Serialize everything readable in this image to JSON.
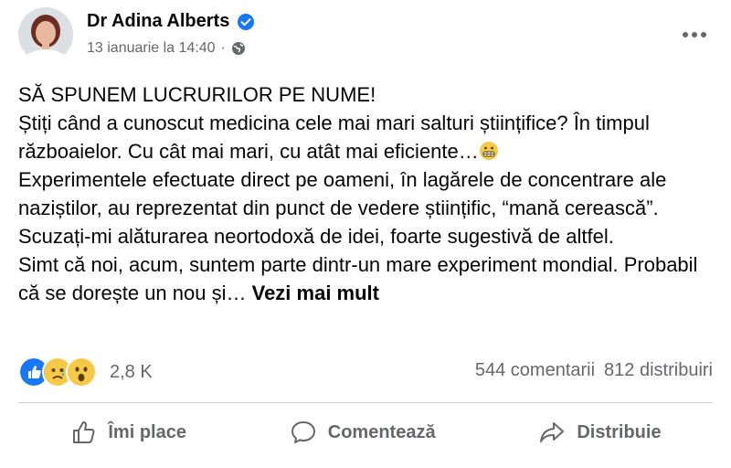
{
  "post": {
    "author": "Dr Adina Alberts",
    "date": "13 ianuarie la 14:40",
    "separator": "·",
    "text_lines": [
      "SĂ SPUNEM LUCRURILOR PE NUME!",
      "Știți când a cunoscut medicina cele mai mari salturi științifice? În timpul războaielor. Cu cât mai mari, cu atât mai eficiente…",
      "Experimentele efectuate direct pe oameni, în lagărele de concentrare ale naziștilor, au reprezentat din punct de vedere științific, “mană cerească”. Scuzați-mi alăturarea neortodoxă de idei, foarte sugestivă de altfel.",
      "Simt că noi, acum, suntem parte dintr-un mare experiment mondial. Probabil că se dorește un nou și…"
    ],
    "see_more": "Vezi mai mult",
    "icons": {
      "verified": "verified-badge-icon",
      "privacy": "globe-icon",
      "more": "more-options-icon"
    }
  },
  "stats": {
    "reactions": [
      "like",
      "sad",
      "wow"
    ],
    "reaction_count": "2,8 K",
    "comments": "544 comentarii",
    "shares": "812 distribuiri"
  },
  "actions": {
    "like": "Îmi place",
    "comment": "Comentează",
    "share": "Distribuie"
  },
  "colors": {
    "accent": "#1877f2",
    "secondary_text": "#65676b",
    "primary_text": "#050505"
  }
}
